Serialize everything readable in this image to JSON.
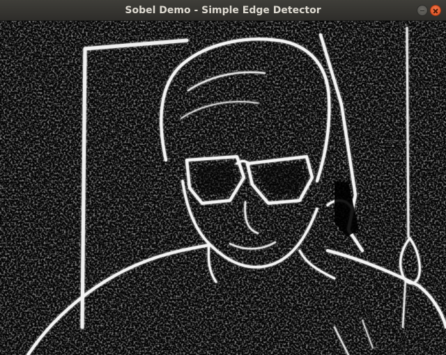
{
  "window": {
    "title": "Sobel Demo - Simple Edge Detector",
    "controls": [
      "minimize-icon",
      "close-icon"
    ]
  },
  "image_view": {
    "content": "sobel-edge-output"
  }
}
